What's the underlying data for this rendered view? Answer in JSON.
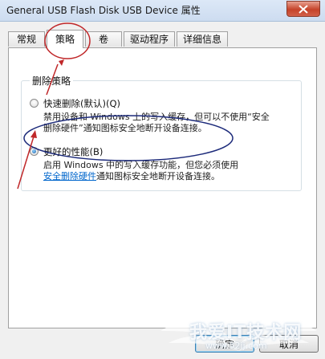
{
  "window": {
    "title": "General USB Flash Disk USB Device 属性"
  },
  "tabs": [
    {
      "label": "常规"
    },
    {
      "label": "策略"
    },
    {
      "label": "卷"
    },
    {
      "label": "驱动程序"
    },
    {
      "label": "详细信息"
    }
  ],
  "active_tab": "策略",
  "group": {
    "legend": "删除策略"
  },
  "options": {
    "quick_removal": {
      "label": "快速删除(默认)(Q)",
      "desc_line1": "禁用设备和 Windows 上的写入缓存，但可以不使用“安全",
      "desc_line2": "删除硬件”通知图标安全地断开设备连接。",
      "selected": false
    },
    "better_performance": {
      "label": "更好的性能(B)",
      "desc_line1": "启用 Windows 中的写入缓存功能，但您必须使用",
      "desc_link": "安全删除硬件",
      "desc_line2_rest": "通知图标安全地断开设备连接。",
      "selected": true
    }
  },
  "buttons": {
    "ok": "确定",
    "cancel": "取消"
  },
  "watermark": {
    "text": "我爱IT技术网",
    "url": "www.52ij.com"
  },
  "colors": {
    "annotation_red": "#c0282a",
    "annotation_navy": "#1c2a7a",
    "link": "#0066cc"
  }
}
